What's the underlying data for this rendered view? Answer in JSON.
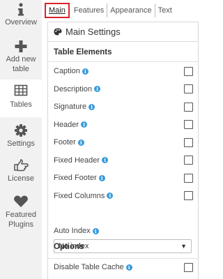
{
  "sidebar": {
    "items": [
      {
        "label": "Overview",
        "icon": "info-icon"
      },
      {
        "label": "Add new table",
        "line1": "Add new",
        "line2": "table",
        "icon": "plus-icon"
      },
      {
        "label": "Tables",
        "icon": "table-icon",
        "active": true
      },
      {
        "label": "Settings",
        "icon": "gear-icon"
      },
      {
        "label": "License",
        "icon": "hand-pointer-icon"
      },
      {
        "label": "Featured Plugins",
        "line1": "Featured",
        "line2": "Plugins",
        "icon": "heart-icon"
      }
    ]
  },
  "tabs": [
    {
      "label": "Main",
      "active": true
    },
    {
      "label": "Features"
    },
    {
      "label": "Appearance"
    },
    {
      "label": "Text"
    }
  ],
  "panel": {
    "title": "Main Settings",
    "icon": "palette-icon",
    "table_elements_heading": "Table Elements",
    "rows": [
      {
        "label": "Caption",
        "checked": false
      },
      {
        "label": "Description",
        "checked": false
      },
      {
        "label": "Signature",
        "checked": false
      },
      {
        "label": "Header",
        "checked": false
      },
      {
        "label": "Footer",
        "checked": false
      },
      {
        "label": "Fixed Header",
        "checked": false
      },
      {
        "label": "Fixed Footer",
        "checked": false
      },
      {
        "label": "Fixed Columns",
        "checked": false
      }
    ],
    "auto_index_label": "Auto Index",
    "auto_index_value": "No index",
    "options_heading": "Options",
    "disable_cache_label": "Disable Table Cache",
    "info_glyph": "i"
  },
  "colors": {
    "accent_red": "#d9232e",
    "info_blue": "#3a9bdc",
    "sidebar_bg": "#f1f1f1"
  }
}
